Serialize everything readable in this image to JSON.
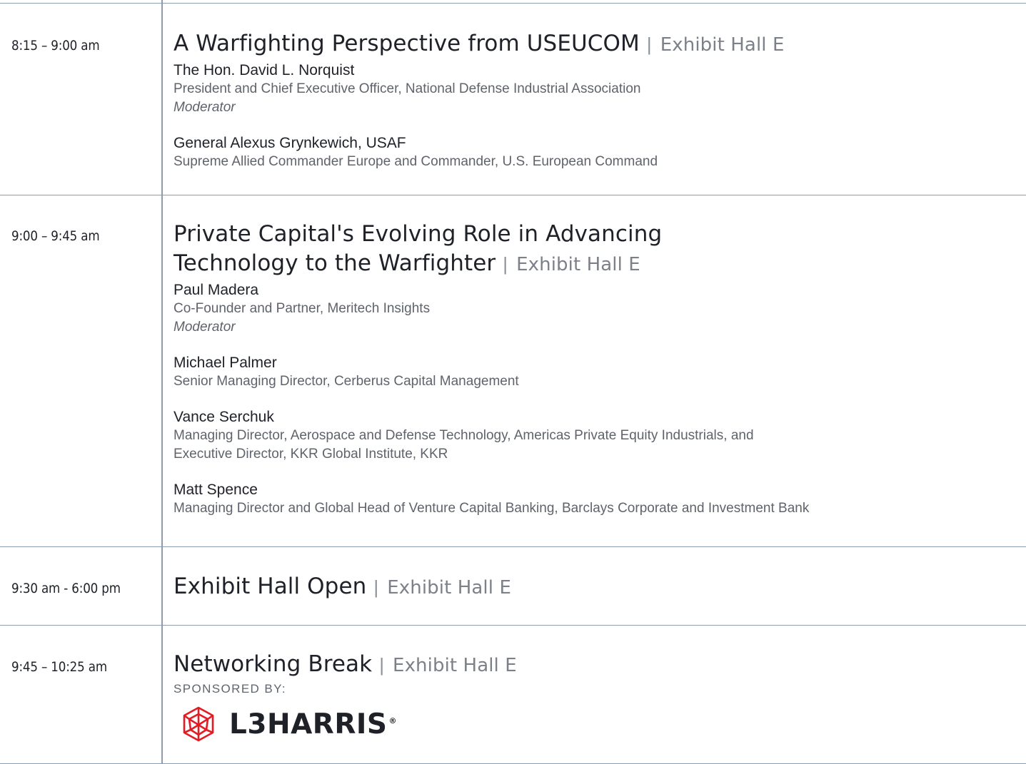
{
  "sessions": [
    {
      "time": "8:15 – 9:00 am",
      "title_lines": [
        "A Warfighting Perspective from USEUCOM"
      ],
      "separator": "|",
      "location": "Exhibit Hall E",
      "speakers": [
        {
          "name": "The Hon. David L. Norquist",
          "roles": [
            "President and Chief Executive Officer, National Defense Industrial Association"
          ],
          "note": "Moderator"
        },
        {
          "name": "General Alexus Grynkewich, USAF",
          "roles": [
            "Supreme Allied Commander Europe and Commander, U.S. European Command"
          ],
          "note": ""
        }
      ]
    },
    {
      "time": "9:00 – 9:45 am",
      "title_lines": [
        "Private Capital's Evolving Role in Advancing",
        "Technology to the Warfighter"
      ],
      "separator": "|",
      "location": "Exhibit Hall E",
      "speakers": [
        {
          "name": "Paul Madera",
          "roles": [
            "Co-Founder and Partner, Meritech Insights"
          ],
          "note": "Moderator"
        },
        {
          "name": "Michael Palmer",
          "roles": [
            "Senior Managing Director, Cerberus Capital Management"
          ],
          "note": ""
        },
        {
          "name": "Vance Serchuk",
          "roles": [
            "Managing Director, Aerospace and Defense Technology, Americas Private Equity Industrials, and",
            "Executive Director, KKR Global Institute, KKR"
          ],
          "note": ""
        },
        {
          "name": "Matt Spence",
          "roles": [
            "Managing Director and Global Head of Venture Capital Banking, Barclays Corporate and Investment Bank"
          ],
          "note": ""
        }
      ]
    },
    {
      "time": "9:30 am - 6:00 pm",
      "title_lines": [
        "Exhibit Hall Open"
      ],
      "separator": "|",
      "location": "Exhibit Hall E",
      "speakers": []
    },
    {
      "time": "9:45 – 10:25 am",
      "title_lines": [
        "Networking Break"
      ],
      "separator": "|",
      "location": "Exhibit Hall E",
      "sponsored_label": "SPONSORED BY:",
      "sponsor_logo_text": "L3HARRIS",
      "sponsor_logo_mark": "®",
      "speakers": []
    }
  ],
  "colors": {
    "rule": "#8c9db1",
    "text": "#1f2128",
    "muted": "#7c8189",
    "logo_red": "#e31b23"
  }
}
